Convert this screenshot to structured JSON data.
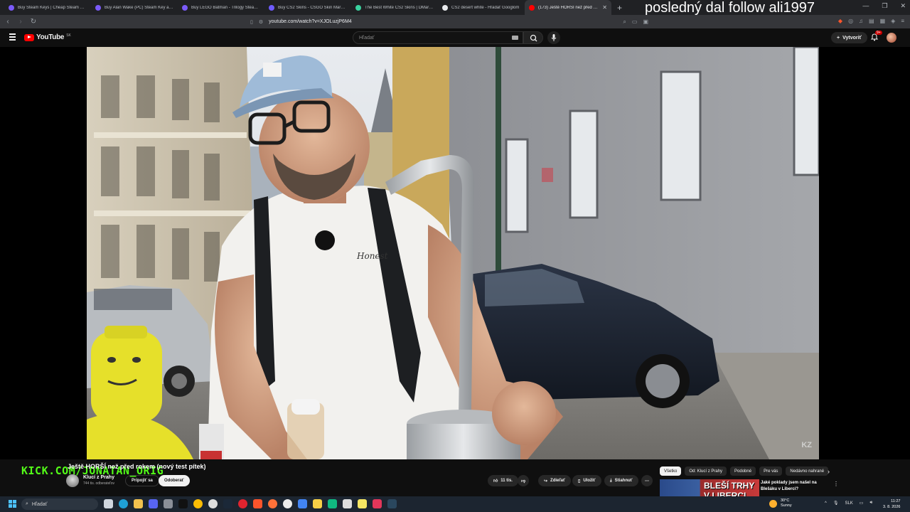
{
  "browser": {
    "tabs": [
      {
        "title": "Buy Steam Keys | Cheap Steam Games",
        "favicon_color": "#7a5af8"
      },
      {
        "title": "Buy Alan Wake (PC) Steam Key at a discount",
        "favicon_color": "#7a5af8"
      },
      {
        "title": "Buy LEGO Batman - Trilogy Steam key",
        "favicon_color": "#7a5af8"
      },
      {
        "title": "Buy CS2 Skins - CSGO Skin Marketplace",
        "favicon_color": "#6e5bff"
      },
      {
        "title": "The Best White CS2 Skins | DMarket",
        "favicon_color": "#3ad29f"
      },
      {
        "title": "CS2 desert white - Hľadať Googlom",
        "favicon_color": "#e8eaed"
      },
      {
        "title": "(173) Ještě HORŠÍ než před rokem",
        "favicon_color": "#ff0000",
        "active": true
      }
    ],
    "new_tab": "+",
    "url": "youtube.com/watch?v=XJOLuzjP6M4",
    "stream_overlay_text": "posledný dal follow ali1997"
  },
  "youtube": {
    "logo_text": "YouTube",
    "logo_country": "SK",
    "search_placeholder": "Hľadať",
    "create_label": "Vytvoriť",
    "notification_count": "9+"
  },
  "video": {
    "watermark": "KZ",
    "stream_link": "KICK.COM/JONATAN_ORIG",
    "title": "Ještě HORŠÍ než před rokem (nový test pítek)",
    "channel_name": "Klucí z Prahy",
    "channel_subs": "744 tis. odberateľov",
    "join_label": "Pripojiť sa",
    "subscribe_label": "Odoberať",
    "likes": "11 tis.",
    "share_label": "Zdieľať",
    "save_label": "Uložiť",
    "download_label": "Stiahnuť"
  },
  "recommendations": {
    "chips": [
      "Všetko",
      "Od: Klucí z Prahy",
      "Podobné",
      "Pre vás",
      "Nedávno nahrané"
    ],
    "first_title": "Jaké poklady jsem našel na Blešáku v Liberci?",
    "first_thumb_text": "BLEŠÍ TRHY V LIBERCI"
  },
  "taskbar": {
    "search_placeholder": "Hľadať",
    "weather_temp": "30°C",
    "weather_desc": "Sunny",
    "lang": "SLK",
    "time": "11:27",
    "date": "3. 8. 2026"
  }
}
